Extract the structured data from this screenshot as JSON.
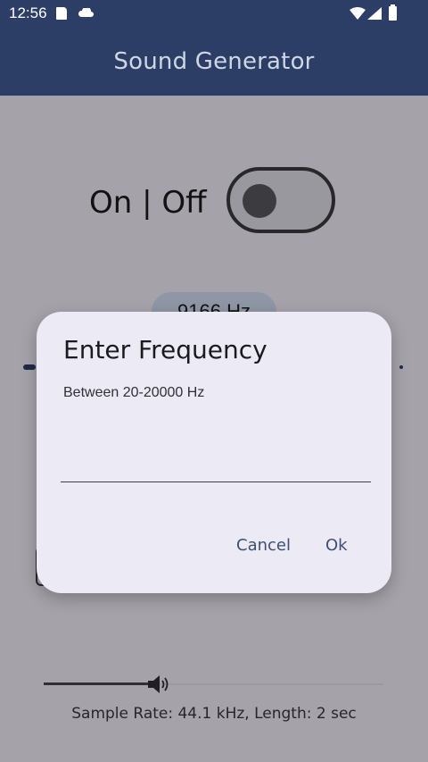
{
  "status": {
    "time": "12:56"
  },
  "appbar": {
    "title": "Sound Generator"
  },
  "main": {
    "onoff_label": "On | Off",
    "frequency_display": "9166 Hz"
  },
  "dialog": {
    "title": "Enter Frequency",
    "subtitle": "Between 20-20000 Hz",
    "input_value": "",
    "cancel_label": "Cancel",
    "ok_label": "Ok"
  },
  "bottom": {
    "sample_info": "Sample Rate: 44.1 kHz, Length: 2 sec",
    "volume_fraction": 0.32
  },
  "colors": {
    "appbar": "#2c3e66",
    "dialog_button": "#3f4f73",
    "dialog_bg": "#eceaf4"
  },
  "icons": [
    "sd-card-icon",
    "cloud-icon",
    "wifi-icon",
    "signal-icon",
    "battery-icon",
    "speaker-icon"
  ]
}
